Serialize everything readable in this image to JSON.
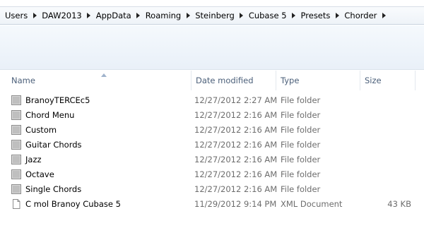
{
  "breadcrumb": {
    "items": [
      "Users",
      "DAW2013",
      "AppData",
      "Roaming",
      "Steinberg",
      "Cubase 5",
      "Presets",
      "Chorder"
    ]
  },
  "columns": {
    "name": "Name",
    "date": "Date modified",
    "type": "Type",
    "size": "Size",
    "sorted_by": "Name"
  },
  "files": [
    {
      "name": "BranoyTERCEc5",
      "date": "12/27/2012 2:27 AM",
      "type": "File folder",
      "size": "",
      "icon": "folder-icon"
    },
    {
      "name": "Chord Menu",
      "date": "12/27/2012 2:16 AM",
      "type": "File folder",
      "size": "",
      "icon": "folder-icon"
    },
    {
      "name": "Custom",
      "date": "12/27/2012 2:16 AM",
      "type": "File folder",
      "size": "",
      "icon": "folder-icon"
    },
    {
      "name": "Guitar Chords",
      "date": "12/27/2012 2:16 AM",
      "type": "File folder",
      "size": "",
      "icon": "folder-icon"
    },
    {
      "name": "Jazz",
      "date": "12/27/2012 2:16 AM",
      "type": "File folder",
      "size": "",
      "icon": "folder-icon"
    },
    {
      "name": "Octave",
      "date": "12/27/2012 2:16 AM",
      "type": "File folder",
      "size": "",
      "icon": "folder-icon"
    },
    {
      "name": "Single Chords",
      "date": "12/27/2012 2:16 AM",
      "type": "File folder",
      "size": "",
      "icon": "folder-icon"
    },
    {
      "name": "C mol Branoy Cubase 5",
      "date": "11/29/2012 9:14 PM",
      "type": "XML Document",
      "size": "43 KB",
      "icon": "document-icon"
    }
  ]
}
